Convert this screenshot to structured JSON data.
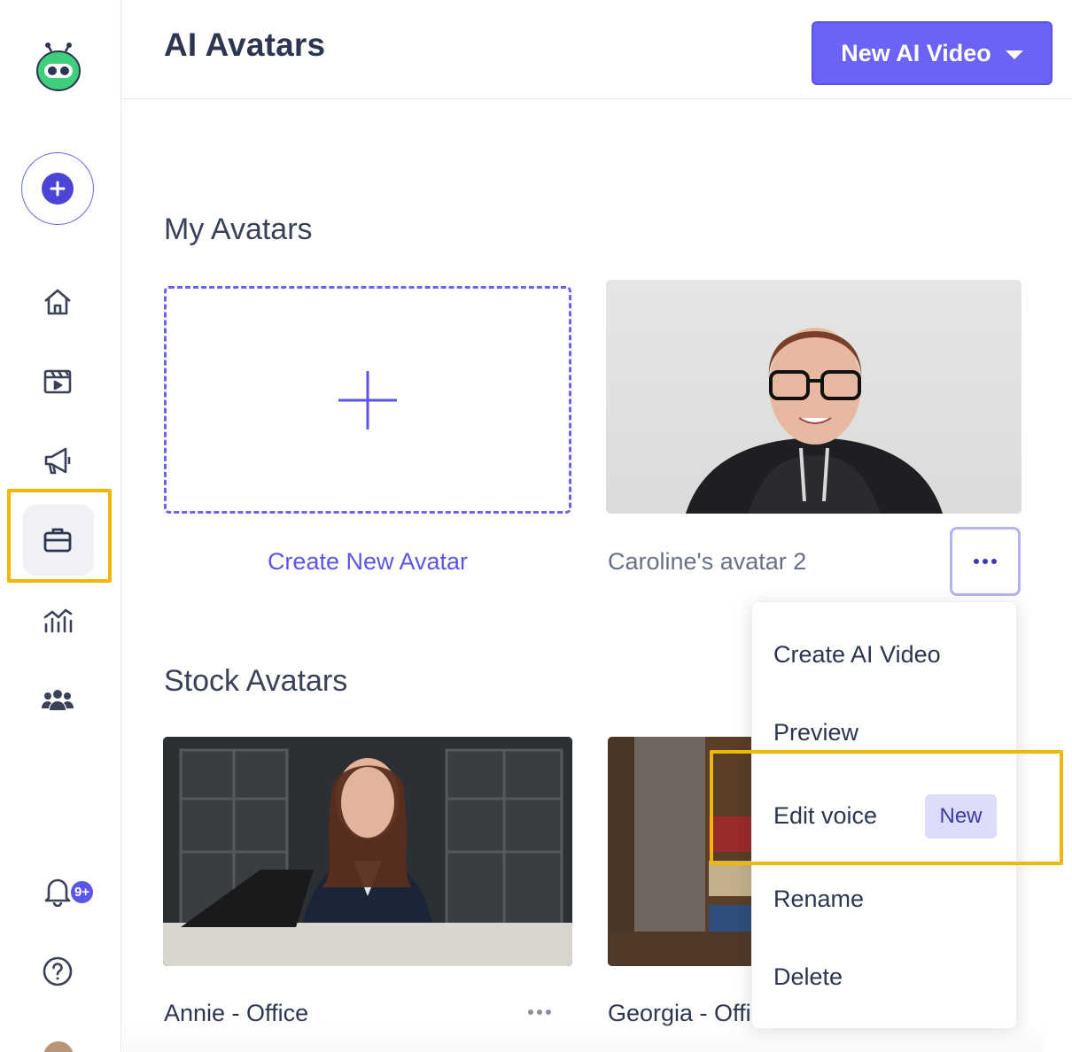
{
  "header": {
    "title": "AI Avatars",
    "new_video_label": "New AI Video"
  },
  "sidebar": {
    "items": [
      {
        "icon": "home-icon"
      },
      {
        "icon": "video-clapper-icon"
      },
      {
        "icon": "megaphone-icon"
      },
      {
        "icon": "briefcase-icon",
        "active": true
      },
      {
        "icon": "analytics-icon"
      },
      {
        "icon": "team-icon"
      }
    ],
    "notifications_badge": "9+",
    "accent": "#5b55ea",
    "highlight_color": "#f2b705"
  },
  "my_avatars": {
    "title": "My Avatars",
    "create_label": "Create New Avatar",
    "cards": [
      {
        "name": "Caroline's avatar 2"
      }
    ]
  },
  "stock_avatars": {
    "title": "Stock Avatars",
    "cards": [
      {
        "name": "Annie - Office"
      },
      {
        "name": "Georgia - Office"
      }
    ]
  },
  "menu": {
    "items": [
      {
        "label": "Create AI Video"
      },
      {
        "label": "Preview"
      },
      {
        "label": "Edit voice",
        "badge": "New"
      },
      {
        "label": "Rename"
      },
      {
        "label": "Delete"
      }
    ]
  }
}
